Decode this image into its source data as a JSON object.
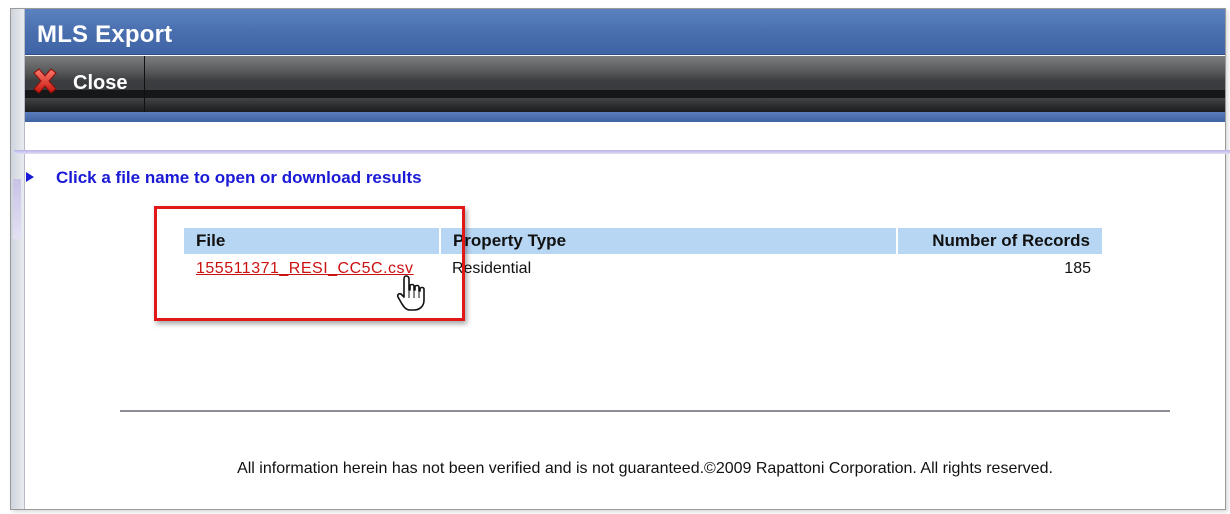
{
  "window": {
    "title": "MLS Export"
  },
  "toolbar": {
    "close_label": "Close",
    "close_icon": "close-x-icon"
  },
  "instruction": {
    "text": "Click a file name to open or download results",
    "icon": "arrow-right-icon"
  },
  "table": {
    "headers": {
      "file": "File",
      "property_type": "Property Type",
      "records": "Number of Records"
    },
    "rows": [
      {
        "file": "155511371_RESI_CC5C.csv",
        "property_type": "Residential",
        "records": "185"
      }
    ]
  },
  "footer": {
    "text": "All information herein has not been verified and is not guaranteed.©2009 Rapattoni Corporation. All rights reserved."
  },
  "colors": {
    "title_bar": "#4a6faf",
    "link": "#cc1111",
    "instruction": "#1a1ad6",
    "header_bg": "#b7d6f4",
    "highlight": "#e01818"
  }
}
